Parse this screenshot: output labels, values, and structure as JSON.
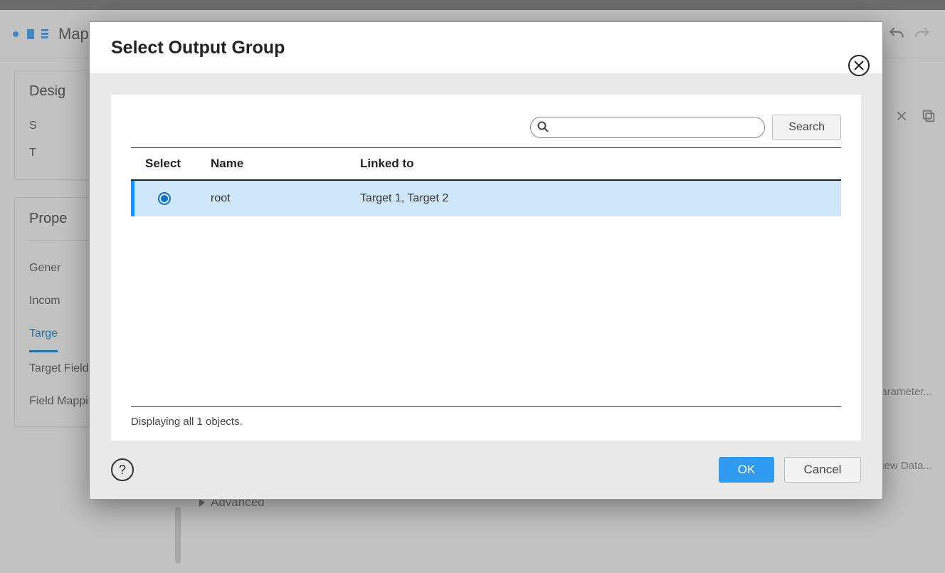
{
  "background": {
    "app_name": "Map",
    "design_header": "Desig",
    "properties_header": "Prope",
    "tabs": {
      "general": "Gener",
      "incoming": "Incom",
      "target": "Targe",
      "target_fields": "Target Fields",
      "field_mapping": "Field Mapping"
    },
    "advanced": "Advanced",
    "right_links": {
      "parameter": "arameter...",
      "view_data": "iew Data..."
    }
  },
  "modal": {
    "title": "Select Output Group",
    "search_button": "Search",
    "search_placeholder": "",
    "columns": {
      "select": "Select",
      "name": "Name",
      "linked_to": "Linked to"
    },
    "rows": [
      {
        "name": "root",
        "linked_to": "Target 1, Target 2",
        "selected": true
      }
    ],
    "status": "Displaying all 1 objects.",
    "help_label": "?",
    "ok": "OK",
    "cancel": "Cancel"
  }
}
